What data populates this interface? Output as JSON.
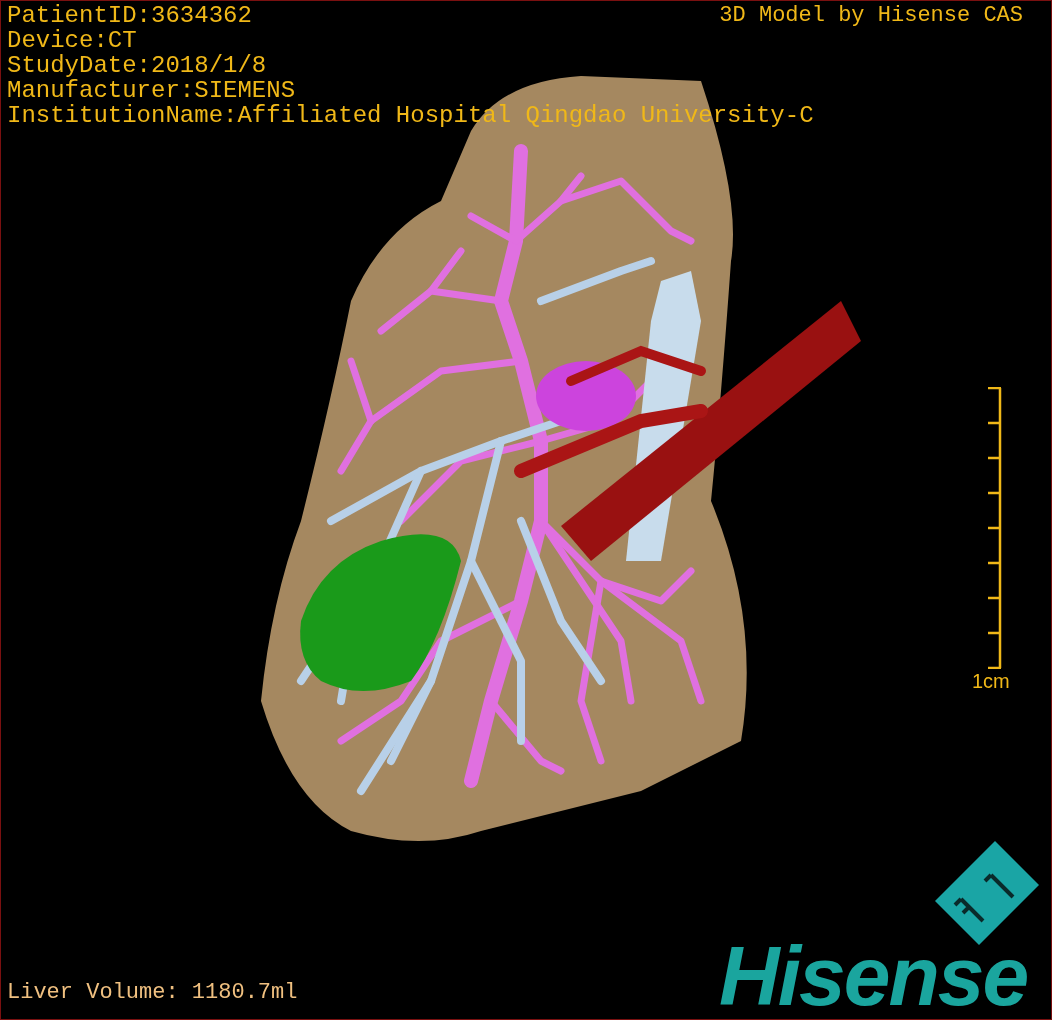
{
  "header": {
    "lines": [
      "PatientID:3634362",
      "Device:CT",
      "StudyDate:2018/1/8",
      "Manufacturer:SIEMENS",
      "InstitutionName:Affiliated Hospital Qingdao University-C"
    ],
    "credit": "3D Model by Hisense CAS"
  },
  "scale": {
    "label": "1cm"
  },
  "footer": {
    "volume": "Liver Volume: 1180.7ml"
  },
  "logo": {
    "text": "Hisense"
  }
}
